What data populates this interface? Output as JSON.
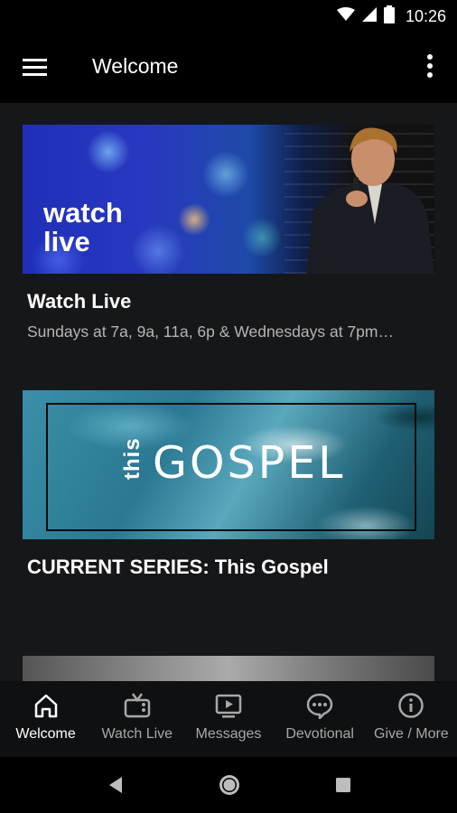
{
  "status_bar": {
    "time": "10:26",
    "icons": [
      "wifi-icon",
      "signal-icon",
      "battery-icon"
    ]
  },
  "app_bar": {
    "title": "Welcome",
    "menu_icon": "hamburger-menu-icon",
    "overflow_icon": "more-vert-icon"
  },
  "cards": [
    {
      "title": "Watch Live",
      "subtitle": "Sundays at 7a, 9a, 11a, 6p & Wednesdays at 7pm…",
      "image": {
        "overlay_text_line1": "watch",
        "overlay_text_line2": "live"
      }
    },
    {
      "title": "CURRENT SERIES:  This Gospel",
      "image": {
        "small_word": "this",
        "big_word": "GOSPEL"
      }
    },
    {
      "title": ""
    }
  ],
  "bottom_nav": {
    "items": [
      {
        "label": "Welcome",
        "icon": "home-icon",
        "active": true
      },
      {
        "label": "Watch Live",
        "icon": "tv-icon",
        "active": false
      },
      {
        "label": "Messages",
        "icon": "video-icon",
        "active": false
      },
      {
        "label": "Devotional",
        "icon": "chat-bubble-icon",
        "active": false
      },
      {
        "label": "Give / More",
        "icon": "info-icon",
        "active": false
      }
    ]
  },
  "system_nav": {
    "icons": [
      "back-icon",
      "home-circle-icon",
      "recents-icon"
    ]
  },
  "colors": {
    "background": "#161719",
    "bar": "#000000",
    "active_label": "#ffffff",
    "inactive_label": "#a8a8a8"
  }
}
